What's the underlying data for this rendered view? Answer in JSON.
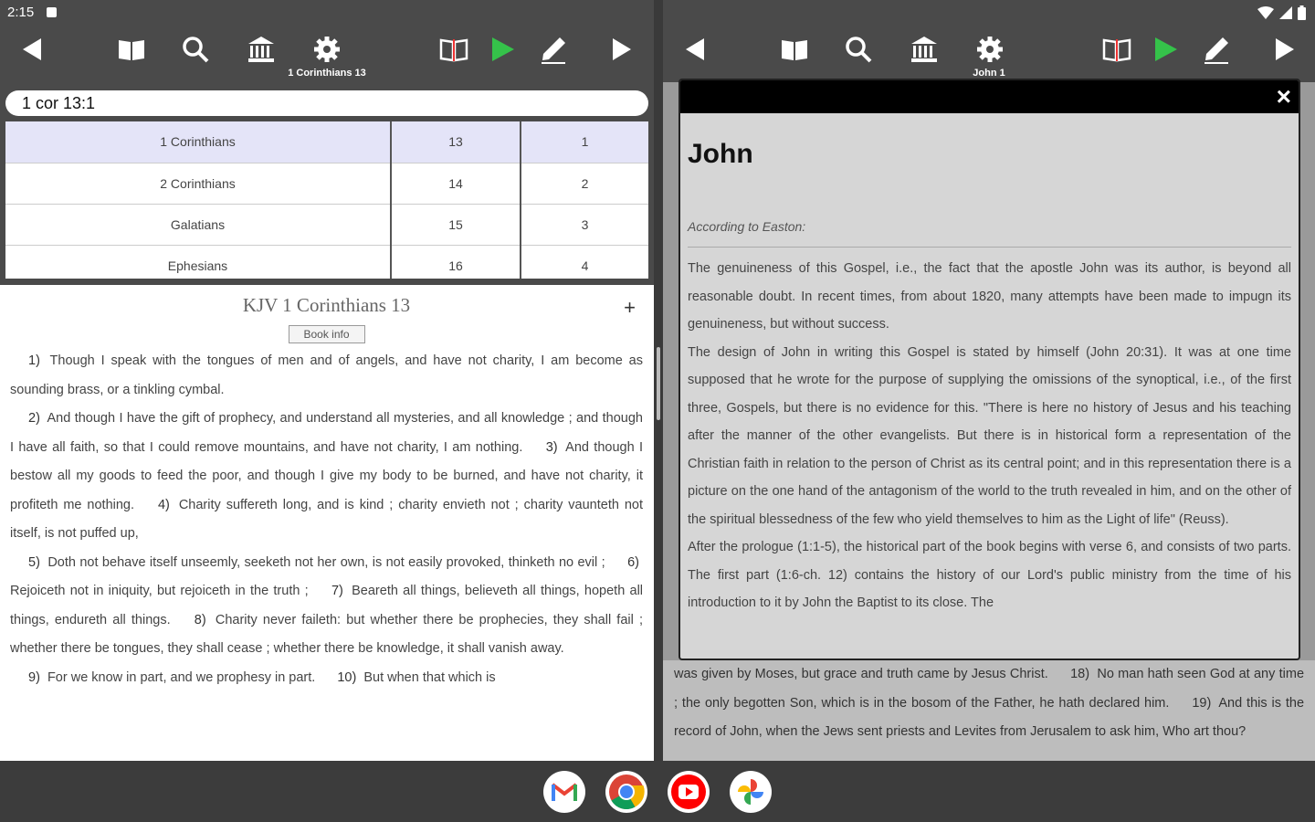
{
  "status": {
    "time": "2:15"
  },
  "left": {
    "toolbar_title": "1 Corinthians 13",
    "search_value": "1 cor 13:1",
    "picker": [
      {
        "book": "1 Corinthians",
        "chapter": "13",
        "verse": "1"
      },
      {
        "book": "2 Corinthians",
        "chapter": "14",
        "verse": "2"
      },
      {
        "book": "Galatians",
        "chapter": "15",
        "verse": "3"
      },
      {
        "book": "Ephesians",
        "chapter": "16",
        "verse": "4"
      }
    ],
    "reader_title": "KJV 1 Corinthians 13",
    "plus_label": "+",
    "book_info_label": "Book info",
    "verses": [
      {
        "n": "1)",
        "t": "Though I speak with the tongues of men and of angels, and have not charity, I am become as sounding brass, or a tinkling cymbal."
      },
      {
        "n": "2)",
        "t": "And though I have the gift of prophecy, and understand all mysteries, and all knowledge ; and though I have all faith, so that I could remove mountains, and have not charity, I am nothing."
      },
      {
        "n": "3)",
        "t": "And though I bestow all my goods to feed the poor, and though I give my body to be burned, and have not charity, it profiteth me nothing."
      },
      {
        "n": "4)",
        "t": "Charity suffereth long, and is kind ; charity envieth not ; charity vaunteth not itself, is not puffed up,"
      },
      {
        "n": "5)",
        "t": "Doth not behave itself unseemly, seeketh not her own, is not easily provoked, thinketh no evil ;"
      },
      {
        "n": "6)",
        "t": "Rejoiceth not in iniquity, but rejoiceth in the truth ;"
      },
      {
        "n": "7)",
        "t": "Beareth all things, believeth all things, hopeth all things, endureth all things."
      },
      {
        "n": "8)",
        "t": "Charity never faileth: but whether there be prophecies, they shall fail ; whether there be tongues, they shall cease ; whether there be knowledge, it shall vanish away."
      },
      {
        "n": "9)",
        "t": "For we know in part, and we prophesy in part."
      },
      {
        "n": "10)",
        "t": "But when that which is"
      }
    ]
  },
  "right": {
    "toolbar_title": "John 1",
    "modal": {
      "close": "×",
      "title": "John",
      "source": "According to Easton:",
      "paragraphs": [
        "The genuineness of this Gospel, i.e., the fact that the apostle John was its author, is beyond all reasonable doubt. In recent times, from about 1820, many attempts have been made to impugn its genuineness, but without success.",
        "The design of John in writing this Gospel is stated by himself (John 20:31). It was at one time supposed that he wrote for the purpose of supplying the omissions of the synoptical, i.e., of the first three, Gospels, but there is no evidence for this. \"There is here no history of Jesus and his teaching after the manner of the other evangelists. But there is in historical form a representation of the Christian faith in relation to the person of Christ as its central point; and in this representation there is a picture on the one hand of the antagonism of the world to the truth revealed in him, and on the other of the spiritual blessedness of the few who yield themselves to him as the Light of life\" (Reuss).",
        "After the prologue (1:1-5), the historical part of the book begins with verse 6, and consists of two parts. The first part (1:6-ch. 12) contains the history of our Lord's public ministry from the time of his introduction to it by John the Baptist to its close. The"
      ]
    },
    "under_text": {
      "line1": "was given by Moses, but grace and truth came by Jesus Christ.",
      "v18n": "18)",
      "v18": "No man hath seen God at any time ; the only begotten Son, which is in the bosom of the Father, he hath declared him.",
      "v19n": "19)",
      "v19": "And this is the record of John, when the Jews sent priests and Levites from Jerusalem to ask him, Who art thou?"
    }
  },
  "dock": [
    "gmail-icon",
    "chrome-icon",
    "youtube-icon",
    "photos-icon"
  ]
}
